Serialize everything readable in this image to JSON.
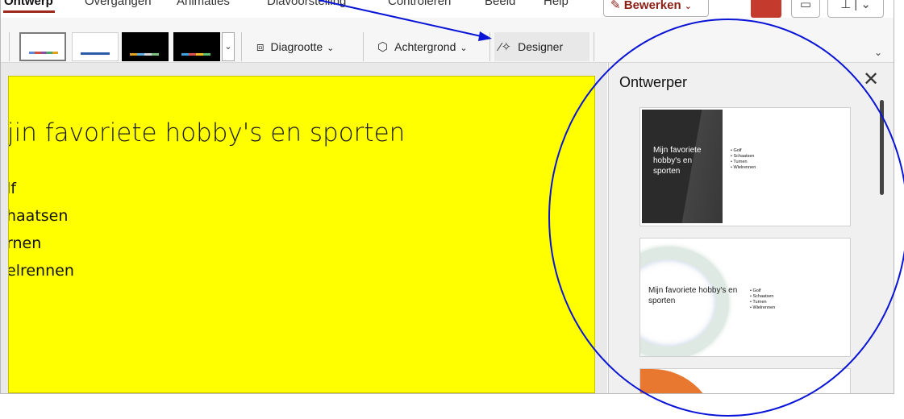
{
  "tabs": [
    "Ontwerp",
    "Overgangen",
    "Animaties",
    "Diavoorstelling",
    "Controleren",
    "Beeld",
    "Help"
  ],
  "edit_button": {
    "label": "Bewerken",
    "icon": "pencil-icon"
  },
  "toolbar_right": {
    "icons": [
      "share-icon",
      "comment-icon",
      "pin-icon",
      "chevron-down-icon"
    ]
  },
  "ribbon": {
    "themes": [
      {
        "bg": "#ffffff",
        "accent": "#8c4fa0"
      },
      {
        "bg": "#ffffff",
        "accent": "#2a5aa8"
      },
      {
        "bg": "#000000",
        "accent": "#d8a300"
      },
      {
        "bg": "#000000",
        "accent": "#3ea1e0"
      }
    ],
    "slide_size_label": "Diagrootte",
    "background_label": "Achtergrond",
    "designer_label": "Designer"
  },
  "slide": {
    "background": "#ffff00",
    "title": "jin favoriete hobby's en sporten",
    "bullets": [
      "lf",
      "haatsen",
      "rnen",
      "elrennen"
    ]
  },
  "designer_pane": {
    "title": "Ontwerper",
    "designs": [
      {
        "title": "Mijn favoriete hobby's en sporten",
        "bullets": [
          "Golf",
          "Schaatsen",
          "Turnen",
          "Wielrennen"
        ]
      },
      {
        "title": "Mijn favoriete hobby's en sporten",
        "bullets": [
          "Golf",
          "Schaatsen",
          "Turnen",
          "Wielrennen"
        ]
      },
      {
        "title": "",
        "bullets": []
      }
    ]
  },
  "annotation": {
    "color": "#0a14d6"
  }
}
